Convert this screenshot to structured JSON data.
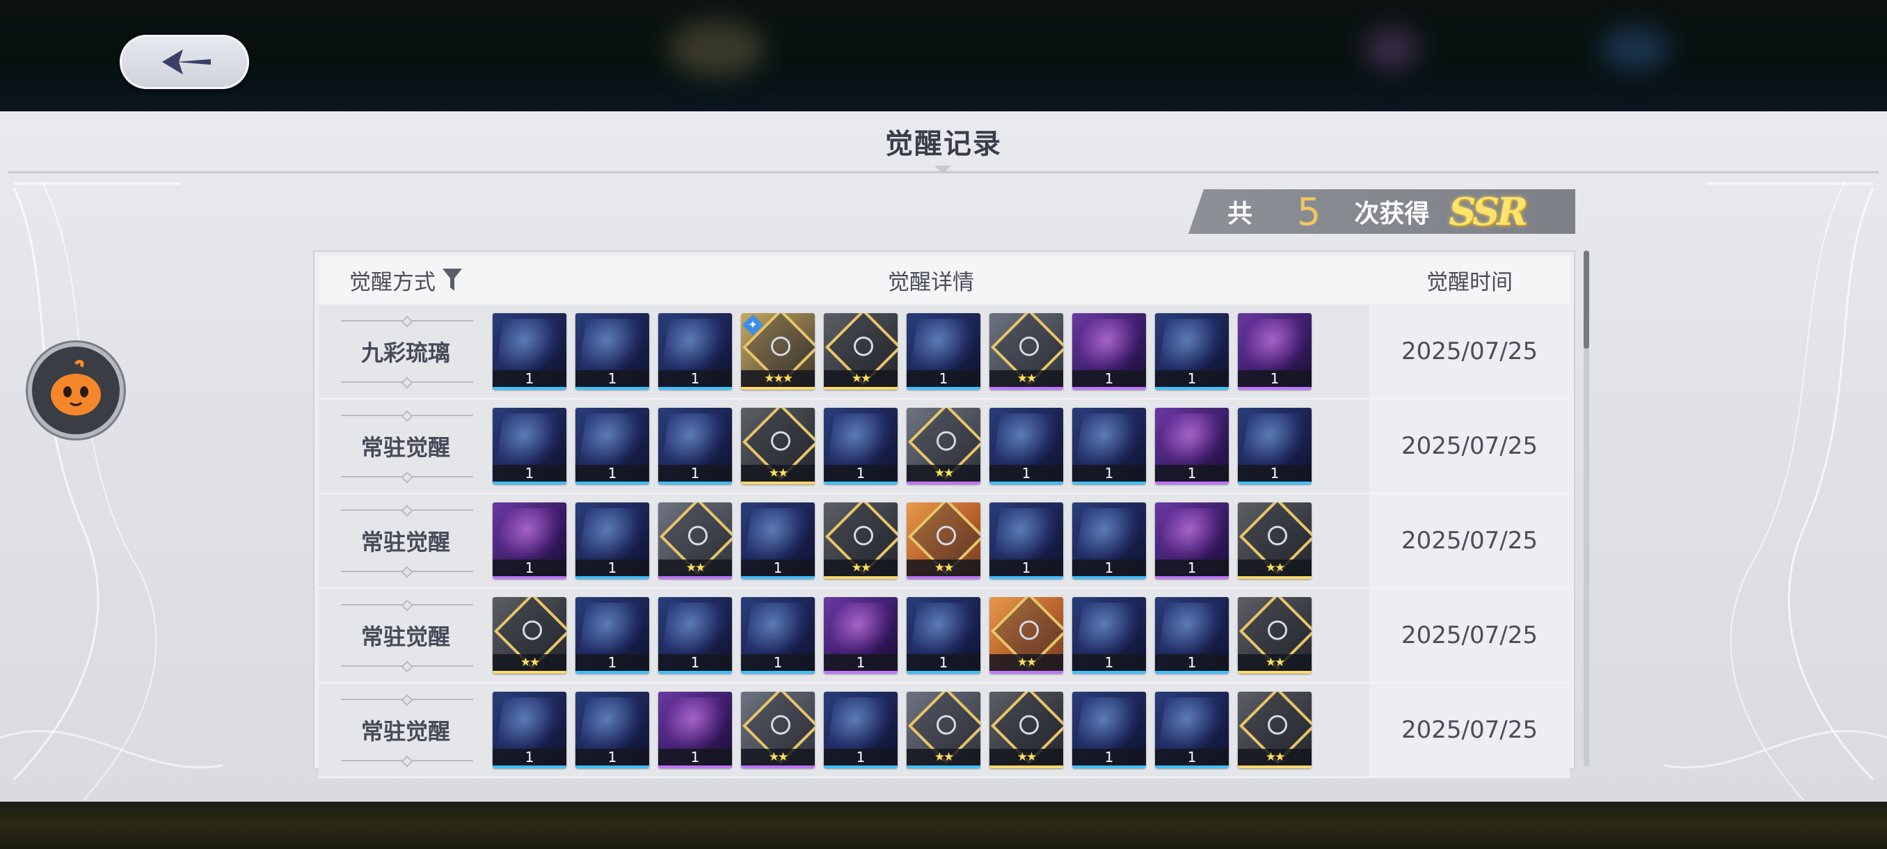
{
  "dialog": {
    "title": "觉醒记录",
    "summary": {
      "prefix": "共",
      "count": "5",
      "suffix": "次获得",
      "rarity": "SSR"
    }
  },
  "table": {
    "headers": {
      "method": "觉醒方式",
      "detail": "觉醒详情",
      "time": "觉醒时间"
    },
    "rows": [
      {
        "method": "九彩琉璃",
        "time": "2025/07/25",
        "cards": [
          {
            "style": "blue",
            "foot": "1"
          },
          {
            "style": "blue",
            "foot": "1"
          },
          {
            "style": "blue",
            "foot": "1"
          },
          {
            "style": "gold",
            "foot": "★★★",
            "new": true
          },
          {
            "style": "dark-gold",
            "foot": "★★"
          },
          {
            "style": "blue",
            "foot": "1"
          },
          {
            "style": "gray",
            "foot": "★★"
          },
          {
            "style": "purple",
            "foot": "1"
          },
          {
            "style": "blue",
            "foot": "1"
          },
          {
            "style": "purple",
            "foot": "1"
          }
        ]
      },
      {
        "method": "常驻觉醒",
        "time": "2025/07/25",
        "cards": [
          {
            "style": "blue",
            "foot": "1"
          },
          {
            "style": "blue",
            "foot": "1"
          },
          {
            "style": "blue",
            "foot": "1"
          },
          {
            "style": "dark-gold",
            "foot": "★★"
          },
          {
            "style": "blue",
            "foot": "1"
          },
          {
            "style": "gray",
            "foot": "★★"
          },
          {
            "style": "blue",
            "foot": "1"
          },
          {
            "style": "blue",
            "foot": "1"
          },
          {
            "style": "purple",
            "foot": "1"
          },
          {
            "style": "blue",
            "foot": "1"
          }
        ]
      },
      {
        "method": "常驻觉醒",
        "time": "2025/07/25",
        "cards": [
          {
            "style": "purple",
            "foot": "1"
          },
          {
            "style": "blue",
            "foot": "1"
          },
          {
            "style": "gray",
            "foot": "★★"
          },
          {
            "style": "blue",
            "foot": "1"
          },
          {
            "style": "dark-gold",
            "foot": "★★"
          },
          {
            "style": "orange",
            "foot": "★★"
          },
          {
            "style": "blue",
            "foot": "1"
          },
          {
            "style": "blue",
            "foot": "1"
          },
          {
            "style": "purple",
            "foot": "1"
          },
          {
            "style": "dark-gold",
            "foot": "★★"
          }
        ]
      },
      {
        "method": "常驻觉醒",
        "time": "2025/07/25",
        "cards": [
          {
            "style": "dark-gold",
            "foot": "★★"
          },
          {
            "style": "blue",
            "foot": "1"
          },
          {
            "style": "blue",
            "foot": "1"
          },
          {
            "style": "blue",
            "foot": "1"
          },
          {
            "style": "purple",
            "foot": "1"
          },
          {
            "style": "blue",
            "foot": "1"
          },
          {
            "style": "orange",
            "foot": "★★"
          },
          {
            "style": "blue",
            "foot": "1"
          },
          {
            "style": "blue",
            "foot": "1"
          },
          {
            "style": "dark-gold",
            "foot": "★★"
          }
        ]
      },
      {
        "method": "常驻觉醒",
        "time": "2025/07/25",
        "cards": [
          {
            "style": "blue",
            "foot": "1"
          },
          {
            "style": "blue",
            "foot": "1"
          },
          {
            "style": "purple",
            "foot": "1"
          },
          {
            "style": "gray",
            "foot": "★★"
          },
          {
            "style": "blue",
            "foot": "1"
          },
          {
            "style": "gray-blue",
            "foot": "★★"
          },
          {
            "style": "dark-gold",
            "foot": "★★"
          },
          {
            "style": "blue",
            "foot": "1"
          },
          {
            "style": "blue",
            "foot": "1"
          },
          {
            "style": "dark-gold",
            "foot": "★★"
          }
        ]
      }
    ]
  },
  "colors": {
    "accent": "#f4c65f",
    "panel": "#e4e6ea",
    "text": "#474a58"
  },
  "icons": {
    "back": "back-arrow-icon",
    "filter": "filter-funnel-icon",
    "mascot": "pumpkin-mascot-icon"
  },
  "scroll": {
    "thumb_fraction": 0.19
  }
}
